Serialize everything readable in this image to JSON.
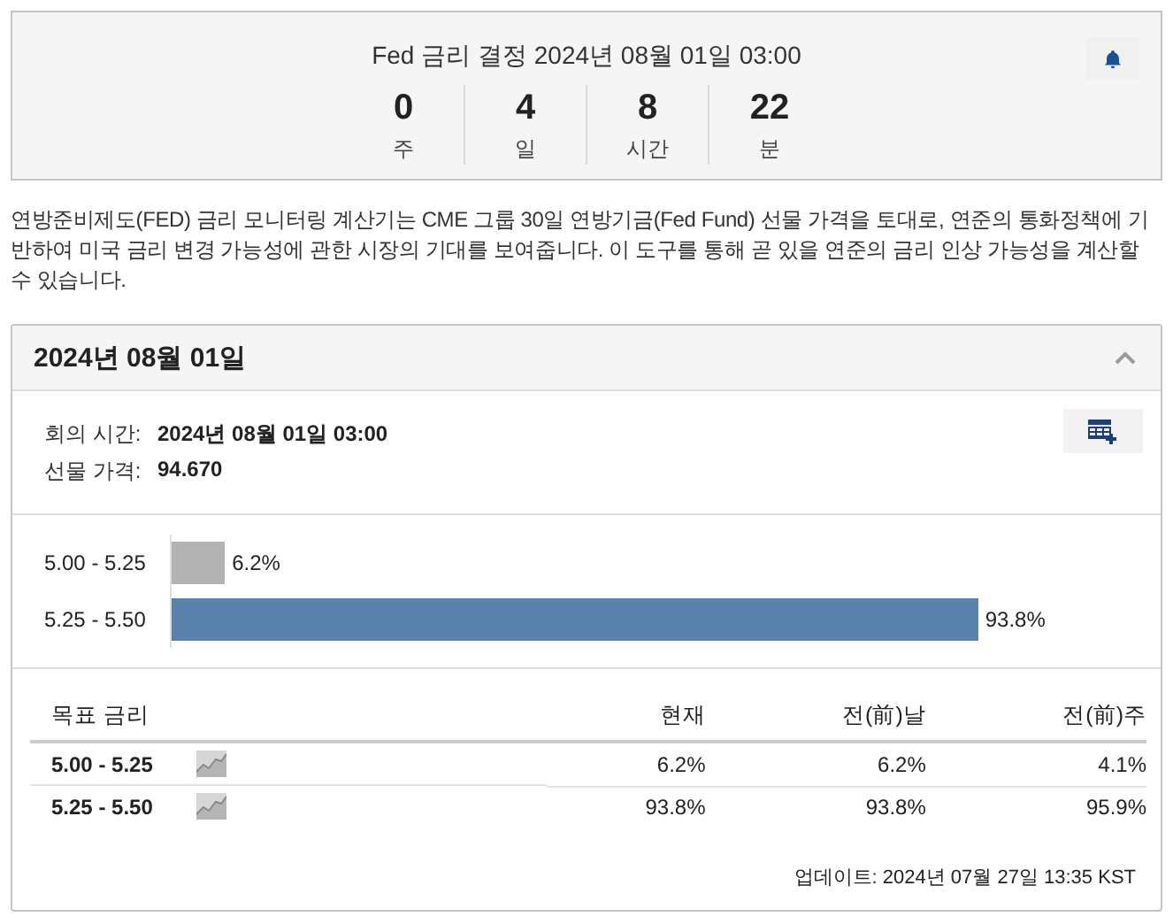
{
  "countdown": {
    "title": "Fed 금리 결정 2024년 08월 01일 03:00",
    "units": [
      {
        "value": "0",
        "label": "주"
      },
      {
        "value": "4",
        "label": "일"
      },
      {
        "value": "8",
        "label": "시간"
      },
      {
        "value": "22",
        "label": "분"
      }
    ]
  },
  "description": "연방준비제도(FED) 금리 모니터링 계산기는 CME 그룹 30일 연방기금(Fed Fund) 선물 가격을 토대로, 연준의 통화정책에 기반하여 미국 금리 변경 가능성에 관한 시장의 기대를 보여줍니다. 이 도구를 통해 곧 있을 연준의 금리 인상 가능성을 계산할 수 있습니다.",
  "meeting": {
    "title": "2024년 08월 01일",
    "expanded": true,
    "info": [
      {
        "label": "회의 시간:",
        "value": "2024년 08월 01일 03:00"
      },
      {
        "label": "선물 가격:",
        "value": "94.670"
      }
    ],
    "chart_data": {
      "type": "bar",
      "orientation": "horizontal",
      "categories": [
        "5.00 - 5.25",
        "5.25 - 5.50"
      ],
      "values": [
        6.2,
        93.8
      ],
      "value_labels": [
        "6.2%",
        "93.8%"
      ]
    },
    "table": {
      "columns": [
        "목표 금리",
        "현재",
        "전(前)날",
        "전(前)주"
      ],
      "rows": [
        [
          "5.00 - 5.25",
          "6.2%",
          "6.2%",
          "4.1%"
        ],
        [
          "5.25 - 5.50",
          "93.8%",
          "93.8%",
          "95.9%"
        ]
      ]
    },
    "updated": "업데이트: 2024년 07월 27일 13:35 KST"
  }
}
